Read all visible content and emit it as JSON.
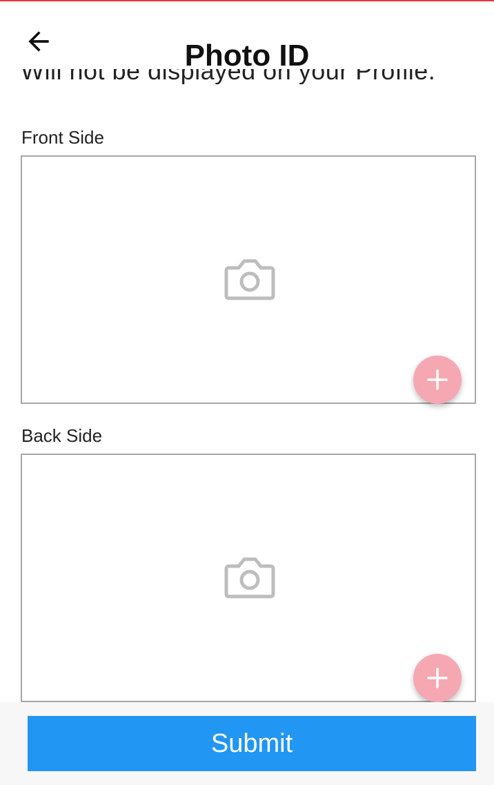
{
  "header": {
    "title": "Photo ID",
    "back_icon": "arrow-left-icon"
  },
  "subtitle": "Will not be displayed on your Profile.",
  "front": {
    "label": "Front Side",
    "placeholder_icon": "camera-icon",
    "add_icon": "plus-icon"
  },
  "back": {
    "label": "Back Side",
    "placeholder_icon": "camera-icon",
    "add_icon": "plus-icon"
  },
  "footer": {
    "submit_label": "Submit"
  },
  "colors": {
    "accent_top": "#e0393e",
    "fab": "#f5a8b1",
    "submit": "#2196f3",
    "camera": "#bdbdbd"
  }
}
